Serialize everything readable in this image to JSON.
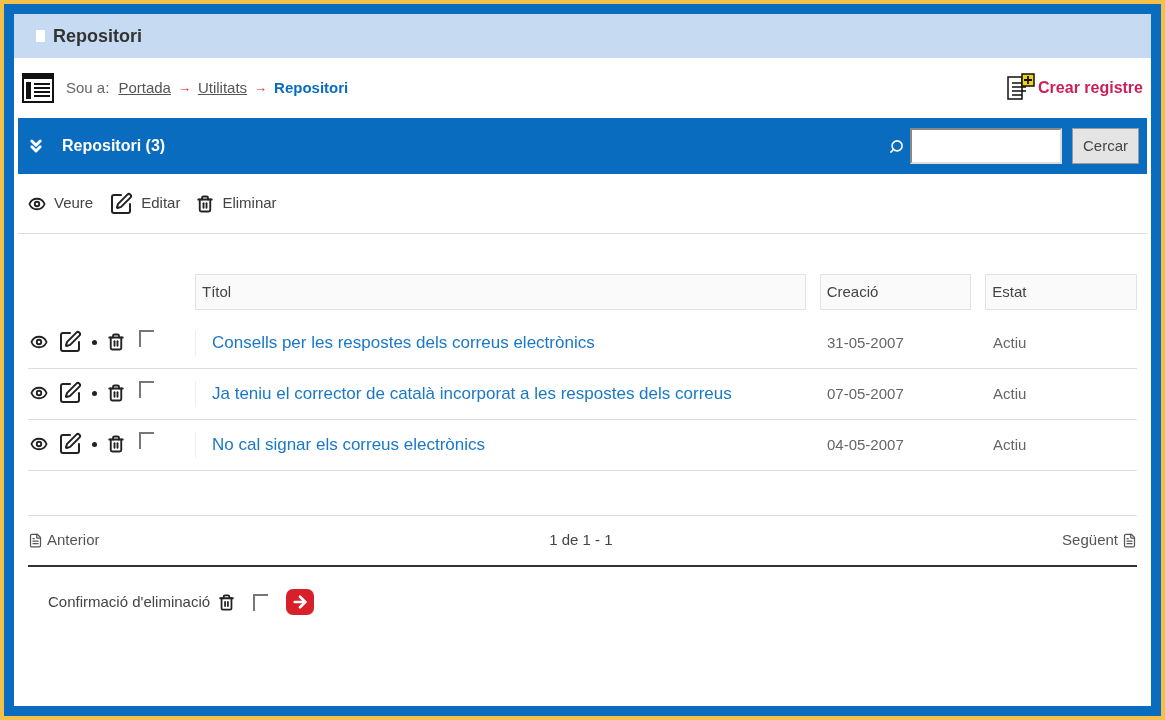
{
  "panel": {
    "title": "Repositori"
  },
  "breadcrumb": {
    "label": "Sou a:",
    "items": [
      {
        "kind": "link",
        "text": "Portada"
      },
      {
        "kind": "separator",
        "text": "→"
      },
      {
        "kind": "link",
        "text": "Utilitats"
      },
      {
        "kind": "separator",
        "text": "→"
      },
      {
        "kind": "current",
        "text": "Repositori"
      }
    ]
  },
  "create_button": {
    "label": "Crear registre"
  },
  "section": {
    "title": "Repositori (3)",
    "search_button": "Cercar"
  },
  "actions": [
    {
      "kind": "view",
      "label": "Veure"
    },
    {
      "kind": "edit",
      "label": "Editar"
    },
    {
      "kind": "delete",
      "label": "Eliminar"
    }
  ],
  "table": {
    "columns": [
      "Títol",
      "Creació",
      "Estat"
    ],
    "rows": [
      {
        "title": "Consells per les respostes dels correus electrònics",
        "created": "31-05-2007",
        "status": "Actiu",
        "checked": false
      },
      {
        "title": "Ja teniu el corrector de català incorporat a les respostes dels correus",
        "created": "07-05-2007",
        "status": "Actiu",
        "checked": false
      },
      {
        "title": "No cal signar els correus electrònics",
        "created": "04-05-2007",
        "status": "Actiu",
        "checked": false
      }
    ]
  },
  "pager": {
    "previous": "Anterior",
    "info": "1 de 1 - 1",
    "next": "Següent"
  },
  "confirm": {
    "label": "Confirmació d'eliminació",
    "checked": false
  }
}
